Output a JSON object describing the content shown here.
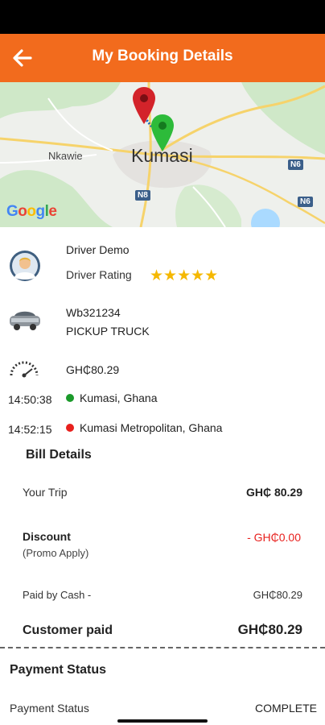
{
  "header": {
    "title": "My Booking Details"
  },
  "map": {
    "city": "Kumasi",
    "places": [
      "Nkawie"
    ],
    "route_shields": [
      "N6",
      "N8",
      "N6"
    ],
    "attribution": "Google"
  },
  "driver": {
    "name": "Driver Demo",
    "rating_label": "Driver Rating",
    "rating_stars": 5,
    "stars_text": "★★★★★"
  },
  "vehicle": {
    "plate": "Wb321234",
    "type": "PICKUP TRUCK"
  },
  "trip": {
    "fare": "GH₵80.29",
    "pickup_time": "14:50:38",
    "pickup": "Kumasi, Ghana",
    "drop_time": "14:52:15",
    "drop": "Kumasi Metropolitan, Ghana"
  },
  "bill": {
    "title": "Bill Details",
    "your_trip_label": "Your Trip",
    "your_trip_value": "GH₵ 80.29",
    "discount_label": "Discount",
    "discount_sub": "(Promo Apply)",
    "discount_value": "- GH₵0.00",
    "paid_by_label": "Paid by Cash -",
    "paid_by_value": "GH₵80.29",
    "customer_paid_label": "Customer paid",
    "customer_paid_value": "GH₵80.29"
  },
  "payment": {
    "title": "Payment Status",
    "label": "Payment Status",
    "value": "COMPLETE"
  },
  "colors": {
    "header": "#f26b1d",
    "pickup_dot": "#1b9a2b",
    "drop_dot": "#e8201d",
    "discount": "#e8201d",
    "stars": "#f5b800"
  }
}
